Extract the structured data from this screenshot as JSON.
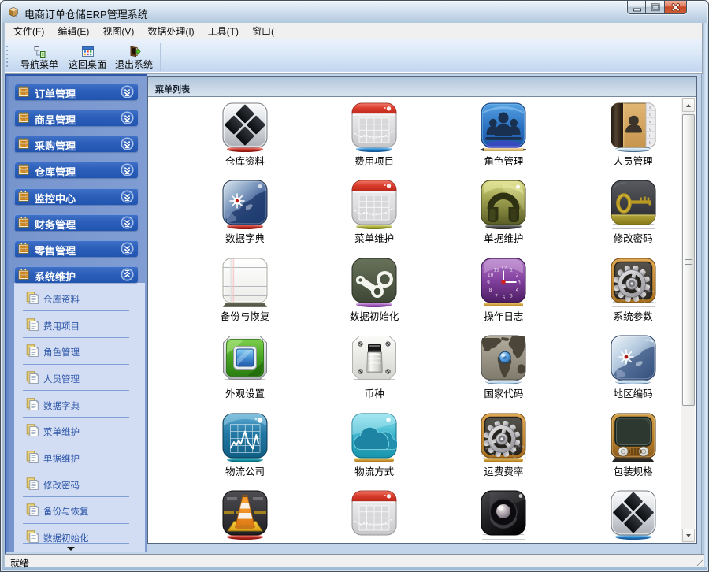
{
  "window": {
    "title": "电商订单仓储ERP管理系统",
    "controls": {
      "minimize": "minimize",
      "maximize": "maximize",
      "close": "close"
    }
  },
  "menu_bar": {
    "items": [
      "文件(F)",
      "编辑(E)",
      "视图(V)",
      "数据处理(I)",
      "工具(T)",
      "窗口("
    ]
  },
  "toolbar": {
    "buttons": [
      {
        "label": "导航菜单",
        "icon": "navigation-menu-icon"
      },
      {
        "label": "这回桌面",
        "icon": "return-desktop-icon"
      },
      {
        "label": "退出系统",
        "icon": "exit-system-icon"
      }
    ]
  },
  "sidebar": {
    "sections": [
      {
        "label": "订单管理",
        "expanded": false
      },
      {
        "label": "商品管理",
        "expanded": false
      },
      {
        "label": "采购管理",
        "expanded": false
      },
      {
        "label": "仓库管理",
        "expanded": false
      },
      {
        "label": "监控中心",
        "expanded": false
      },
      {
        "label": "财务管理",
        "expanded": false
      },
      {
        "label": "零售管理",
        "expanded": false
      },
      {
        "label": "系统维护",
        "expanded": true
      }
    ],
    "expanded_items": [
      "仓库资料",
      "费用项目",
      "角色管理",
      "人员管理",
      "数据字典",
      "菜单维护",
      "单据维护",
      "修改密码",
      "备份与恢复",
      "数据初始化"
    ]
  },
  "content": {
    "panel_title": "菜单列表",
    "tiles": [
      {
        "label": "仓库资料",
        "icon": "ic-diamonds",
        "reflection": "rf-ellipse rf-red"
      },
      {
        "label": "费用项目",
        "icon": "ic-calendar",
        "reflection": "rf-ellipse rf-blue"
      },
      {
        "label": "角色管理",
        "icon": "ic-users",
        "reflection": "rf-pencil"
      },
      {
        "label": "人员管理",
        "icon": "ic-book",
        "reflection": "rf-ellipse rf-skyblue"
      },
      {
        "label": "数据字典",
        "icon": "ic-mapdark",
        "reflection": "rf-ellipse rf-red"
      },
      {
        "label": "菜单维护",
        "icon": "ic-calendar",
        "reflection": "rf-ellipse rf-green"
      },
      {
        "label": "单据维护",
        "icon": "ic-headphones",
        "reflection": "rf-ellipse rf-gray"
      },
      {
        "label": "修改密码",
        "icon": "ic-key",
        "reflection": "rf-outline"
      },
      {
        "label": "备份与恢复",
        "icon": "ic-notepad",
        "reflection": "rf-olivetrap"
      },
      {
        "label": "数据初始化",
        "icon": "ic-steam",
        "reflection": "rf-ellipse rf-violet"
      },
      {
        "label": "操作日志",
        "icon": "ic-clock",
        "reflection": "rf-amber"
      },
      {
        "label": "系统参数",
        "icon": "ic-gears",
        "reflection": "rf-outline"
      },
      {
        "label": "外观设置",
        "icon": "ic-nested",
        "reflection": "rf-outline"
      },
      {
        "label": "币种",
        "icon": "ic-switch",
        "reflection": "rf-outline"
      },
      {
        "label": "国家代码",
        "icon": "ic-worldmap",
        "reflection": "rf-ellipse rf-skyblue"
      },
      {
        "label": "地区编码",
        "icon": "ic-maplight",
        "reflection": "rf-ellipse rf-skyblue"
      },
      {
        "label": "物流公司",
        "icon": "ic-chart",
        "reflection": "rf-ellipse rf-teal"
      },
      {
        "label": "物流方式",
        "icon": "ic-clouds",
        "reflection": "rf-amber"
      },
      {
        "label": "运费费率",
        "icon": "ic-gears",
        "reflection": "rf-amber"
      },
      {
        "label": "包装规格",
        "icon": "ic-tv",
        "reflection": "rf-darktrap"
      },
      {
        "label": "",
        "icon": "ic-vlccone",
        "reflection": "rf-ellipse rf-red"
      },
      {
        "label": "",
        "icon": "ic-calendar",
        "reflection": "rf-none"
      },
      {
        "label": "",
        "icon": "ic-lens",
        "reflection": "rf-outline"
      },
      {
        "label": "",
        "icon": "ic-diamonds",
        "reflection": "rf-ellipse rf-blue"
      }
    ]
  },
  "status_bar": {
    "text": "就绪"
  }
}
